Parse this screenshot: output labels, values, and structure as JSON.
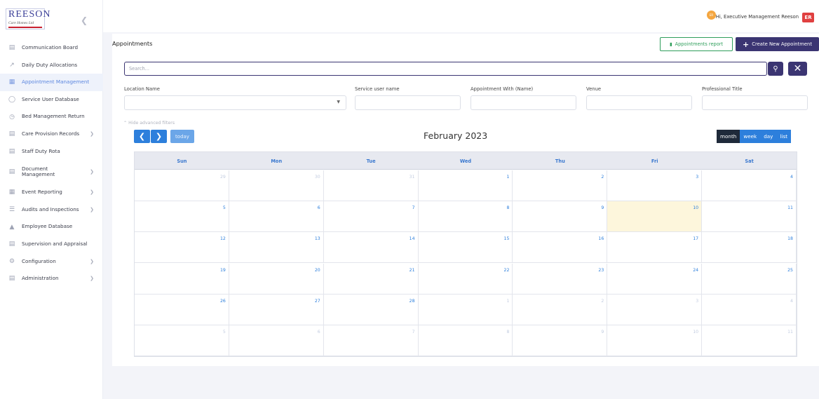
{
  "brand": {
    "logo_top": "REESON",
    "logo_sub": "Care Homes Ltd"
  },
  "topbar": {
    "greeting": "Hi, Executive Management Reeson",
    "user_initials": "ER",
    "avatar_text": "ER"
  },
  "sidebar": {
    "items": [
      {
        "label": "Communication Board",
        "icon": "clipboard-icon",
        "chevron": false,
        "active": false
      },
      {
        "label": "Daily Duty Allocations",
        "icon": "route-icon",
        "chevron": false,
        "active": false
      },
      {
        "label": "Appointment Management",
        "icon": "calendar-icon",
        "chevron": false,
        "active": true
      },
      {
        "label": "Service User Database",
        "icon": "user-icon",
        "chevron": false,
        "active": false
      },
      {
        "label": "Bed Management Return",
        "icon": "clock-icon",
        "chevron": false,
        "active": false
      },
      {
        "label": "Care Provision Records",
        "icon": "file-icon",
        "chevron": true,
        "active": false
      },
      {
        "label": "Staff Duty Rota",
        "icon": "table-icon",
        "chevron": false,
        "active": false
      },
      {
        "label": "Document Management",
        "icon": "folder-icon",
        "chevron": true,
        "active": false
      },
      {
        "label": "Event Reporting",
        "icon": "calendar-icon",
        "chevron": true,
        "active": false
      },
      {
        "label": "Audits and Inspections",
        "icon": "list-icon",
        "chevron": true,
        "active": false
      },
      {
        "label": "Employee Database",
        "icon": "bank-icon",
        "chevron": false,
        "active": false
      },
      {
        "label": "Supervision and Appraisal",
        "icon": "form-icon",
        "chevron": false,
        "active": false
      },
      {
        "label": "Configuration",
        "icon": "gear-icon",
        "chevron": true,
        "active": false
      },
      {
        "label": "Administration",
        "icon": "settings-icon",
        "chevron": true,
        "active": false
      }
    ]
  },
  "main": {
    "title": "Appointments",
    "report_button": "Appointments report",
    "create_button": "Create New Appointment",
    "search_placeholder": "Search...",
    "filters": [
      {
        "label": "Location Name"
      },
      {
        "label": "Service user name"
      },
      {
        "label": "Appointment With (Name)"
      },
      {
        "label": "Venue"
      },
      {
        "label": "Professional Title"
      }
    ],
    "hide_filters": "Hide advanced filters"
  },
  "calendar": {
    "title": "February 2023",
    "today_label": "today",
    "views": [
      "month",
      "week",
      "day",
      "list"
    ],
    "active_view": "month",
    "weekdays": [
      "Sun",
      "Mon",
      "Tue",
      "Wed",
      "Thu",
      "Fri",
      "Sat"
    ],
    "weeks": [
      [
        {
          "d": "29",
          "o": true
        },
        {
          "d": "30",
          "o": true
        },
        {
          "d": "31",
          "o": true
        },
        {
          "d": "1",
          "o": false
        },
        {
          "d": "2",
          "o": false
        },
        {
          "d": "3",
          "o": false
        },
        {
          "d": "4",
          "o": false
        }
      ],
      [
        {
          "d": "5",
          "o": false
        },
        {
          "d": "6",
          "o": false
        },
        {
          "d": "7",
          "o": false
        },
        {
          "d": "8",
          "o": false
        },
        {
          "d": "9",
          "o": false
        },
        {
          "d": "10",
          "o": false,
          "t": true
        },
        {
          "d": "11",
          "o": false
        }
      ],
      [
        {
          "d": "12",
          "o": false
        },
        {
          "d": "13",
          "o": false
        },
        {
          "d": "14",
          "o": false
        },
        {
          "d": "15",
          "o": false
        },
        {
          "d": "16",
          "o": false
        },
        {
          "d": "17",
          "o": false
        },
        {
          "d": "18",
          "o": false
        }
      ],
      [
        {
          "d": "19",
          "o": false
        },
        {
          "d": "20",
          "o": false
        },
        {
          "d": "21",
          "o": false
        },
        {
          "d": "22",
          "o": false
        },
        {
          "d": "23",
          "o": false
        },
        {
          "d": "24",
          "o": false
        },
        {
          "d": "25",
          "o": false
        }
      ],
      [
        {
          "d": "26",
          "o": false
        },
        {
          "d": "27",
          "o": false
        },
        {
          "d": "28",
          "o": false
        },
        {
          "d": "1",
          "o": true
        },
        {
          "d": "2",
          "o": true
        },
        {
          "d": "3",
          "o": true
        },
        {
          "d": "4",
          "o": true
        }
      ],
      [
        {
          "d": "5",
          "o": true
        },
        {
          "d": "6",
          "o": true
        },
        {
          "d": "7",
          "o": true
        },
        {
          "d": "8",
          "o": true
        },
        {
          "d": "9",
          "o": true
        },
        {
          "d": "10",
          "o": true
        },
        {
          "d": "11",
          "o": true
        }
      ]
    ]
  },
  "colors": {
    "accent": "#3b3572",
    "link": "#2d7fdc",
    "active_nav": "#5b86df"
  }
}
